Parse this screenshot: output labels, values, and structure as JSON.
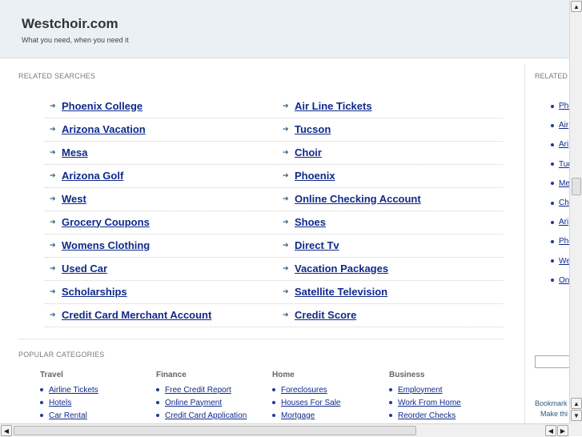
{
  "header": {
    "site_title": "Westchoir.com",
    "tagline": "What you need, when you need it"
  },
  "related_searches": {
    "label": "RELATED SEARCHES",
    "rows": [
      [
        "Phoenix College",
        "Air Line Tickets"
      ],
      [
        "Arizona Vacation",
        "Tucson"
      ],
      [
        "Mesa",
        "Choir"
      ],
      [
        "Arizona Golf",
        "Phoenix"
      ],
      [
        "West",
        "Online Checking Account"
      ],
      [
        "Grocery Coupons",
        "Shoes"
      ],
      [
        "Womens Clothing",
        "Direct Tv"
      ],
      [
        "Used Car",
        "Vacation Packages"
      ],
      [
        "Scholarships",
        "Satellite Television"
      ],
      [
        "Credit Card Merchant Account",
        "Credit Score"
      ]
    ]
  },
  "popular_categories": {
    "label": "POPULAR CATEGORIES",
    "columns": [
      {
        "title": "Travel",
        "links": [
          "Airline Tickets",
          "Hotels",
          "Car Rental"
        ]
      },
      {
        "title": "Finance",
        "links": [
          "Free Credit Report",
          "Online Payment",
          "Credit Card Application"
        ]
      },
      {
        "title": "Home",
        "links": [
          "Foreclosures",
          "Houses For Sale",
          "Mortgage"
        ]
      },
      {
        "title": "Business",
        "links": [
          "Employment",
          "Work From Home",
          "Reorder Checks"
        ]
      }
    ]
  },
  "right_panel": {
    "label": "RELATED",
    "items": [
      "Pho",
      "Air",
      "Ari",
      "Tuc",
      "Me",
      "Ch",
      "Ari",
      "Pho",
      "We",
      "Onl"
    ],
    "bookmark": "Bookmark",
    "make_this": "Make thi"
  },
  "scrollbars": {
    "up_arrow": "▲",
    "down_arrow": "▼",
    "left_arrow": "◀",
    "right_arrow": "▶"
  }
}
